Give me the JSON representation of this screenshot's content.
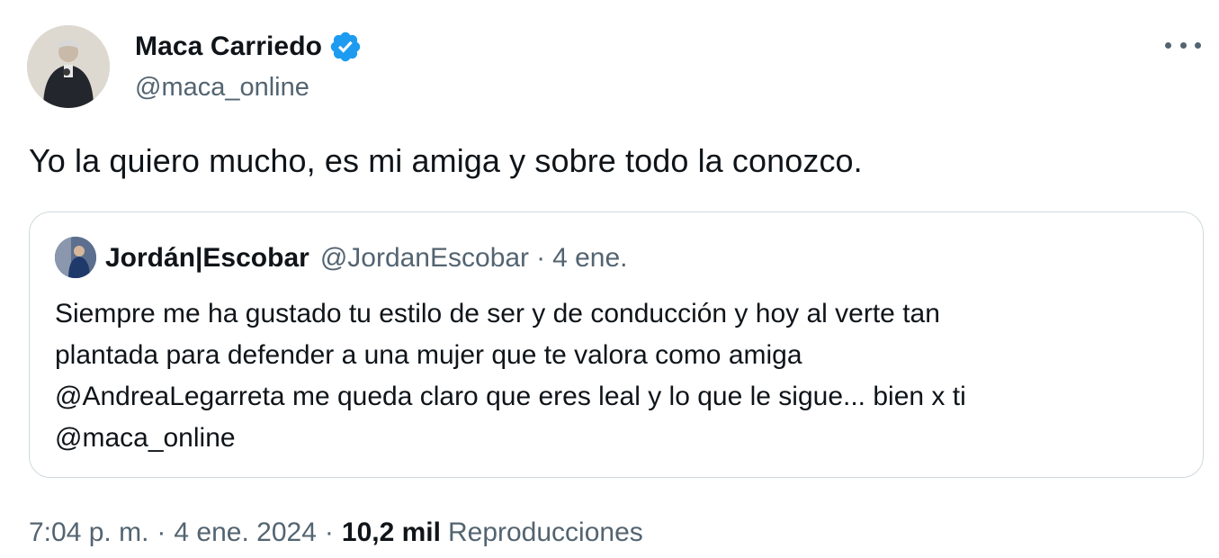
{
  "tweet": {
    "author": {
      "name": "Maca Carriedo",
      "handle": "@maca_online",
      "verified": true,
      "avatar_icon": "profile-photo"
    },
    "more_icon": "more-options-icon",
    "text": "Yo la quiero mucho, es mi amiga y sobre todo la conozco.",
    "quote": {
      "name": "Jordán|Escobar",
      "handle": "@JordanEscobar",
      "separator": "·",
      "date": "4 ene.",
      "lines": [
        "Siempre me ha gustado tu estilo de ser y de conducción y hoy al verte tan",
        "plantada para defender a una mujer que te valora como amiga",
        "@AndreaLegarreta  me queda claro que eres leal y lo que le sigue... bien x ti",
        "@maca_online"
      ]
    },
    "meta": {
      "time": "7:04 p. m.",
      "separator": "·",
      "date": "4 ene. 2024",
      "views_count": "10,2 mil",
      "views_label": "Reproducciones"
    }
  },
  "colors": {
    "text": "#0f1419",
    "secondary": "#536471",
    "border": "#cfd9de",
    "verified": "#1d9bf0"
  }
}
